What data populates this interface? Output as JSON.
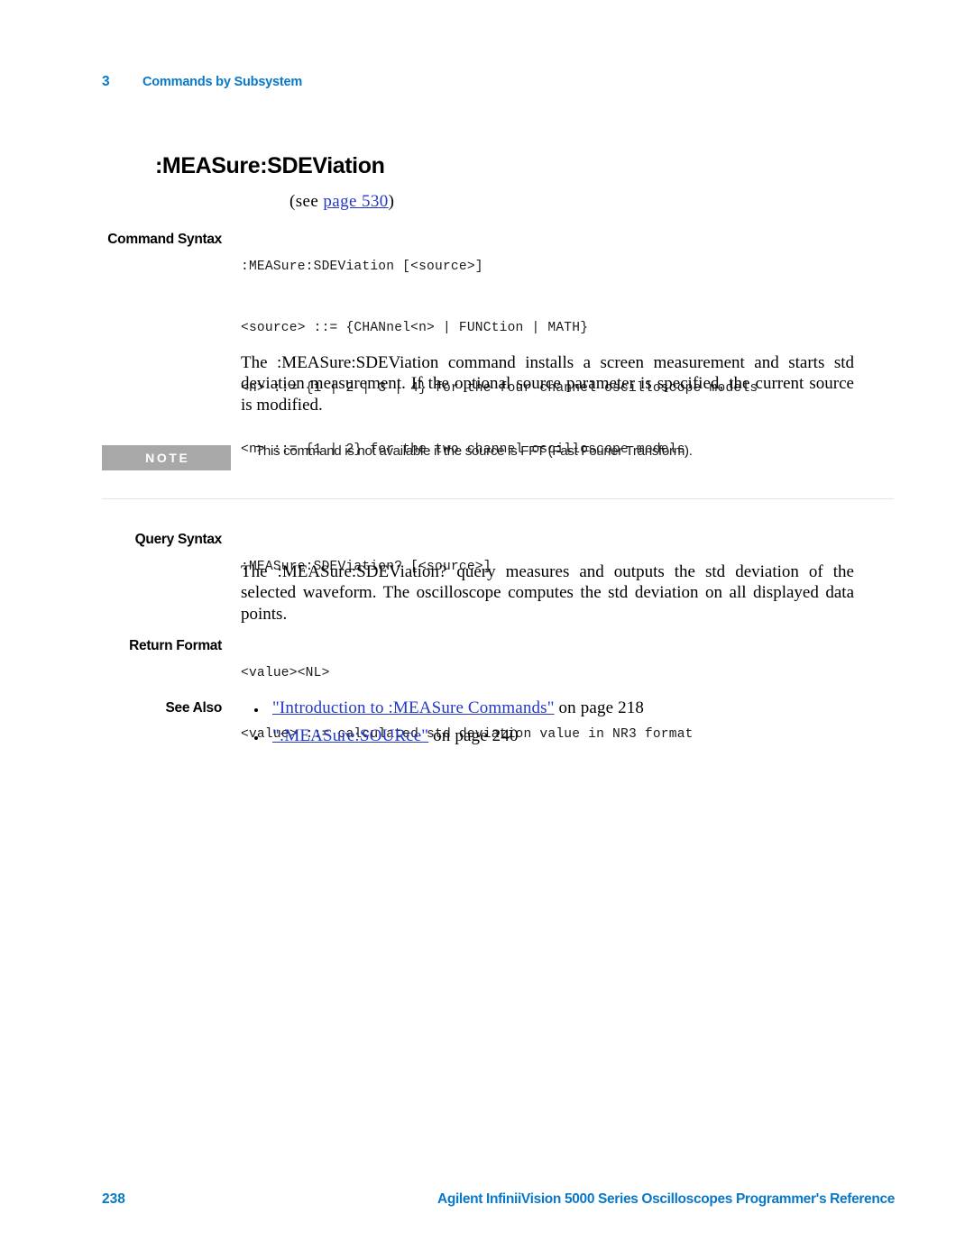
{
  "header": {
    "chapter_number": "3",
    "chapter_title": "Commands by Subsystem"
  },
  "command": {
    "title": ":MEASure:SDEViation",
    "see_prefix": "(see",
    "see_link": "page  530",
    "see_suffix": ")"
  },
  "command_syntax": {
    "label": "Command Syntax",
    "lines": [
      ":MEASure:SDEViation [<source>]",
      "<source> ::= {CHANnel<n> | FUNCtion | MATH}",
      "<n> ::= {1 | 2 | 3 | 4} for the four channel oscilloscope models",
      "<n> ::= {1 | 2} for the two channel oscilloscope models"
    ],
    "description": "The :MEASure:SDEViation command installs a screen measurement and starts std deviation measurement. If the optional source parameter is specified, the current source is modified."
  },
  "note": {
    "badge": "NOTE",
    "text": "This command is not available if the source is FFT (Fast Fourier Transform)."
  },
  "query_syntax": {
    "label": "Query Syntax",
    "line": ":MEASure:SDEViation? [<source>]",
    "description": "The :MEASure:SDEViation? query measures and outputs the std deviation of the selected waveform. The oscilloscope computes the std deviation on all displayed data points."
  },
  "return_format": {
    "label": "Return Format",
    "lines": [
      "<value><NL>",
      "<value> ::= calculated std deviation value in NR3 format"
    ]
  },
  "see_also": {
    "label": "See Also",
    "items": [
      {
        "link": "\"Introduction  to  :MEASure  Commands\"",
        "tail": " on page  218"
      },
      {
        "link": "\":MEASure:SOURce\"",
        "tail": " on page  240"
      }
    ]
  },
  "footer": {
    "page_number": "238",
    "title": "Agilent InfiniiVision 5000 Series Oscilloscopes Programmer's Reference"
  },
  "colors": {
    "accent_blue": "#0878c8",
    "link_blue": "#2438c8",
    "note_gray": "#a8a8a8"
  }
}
